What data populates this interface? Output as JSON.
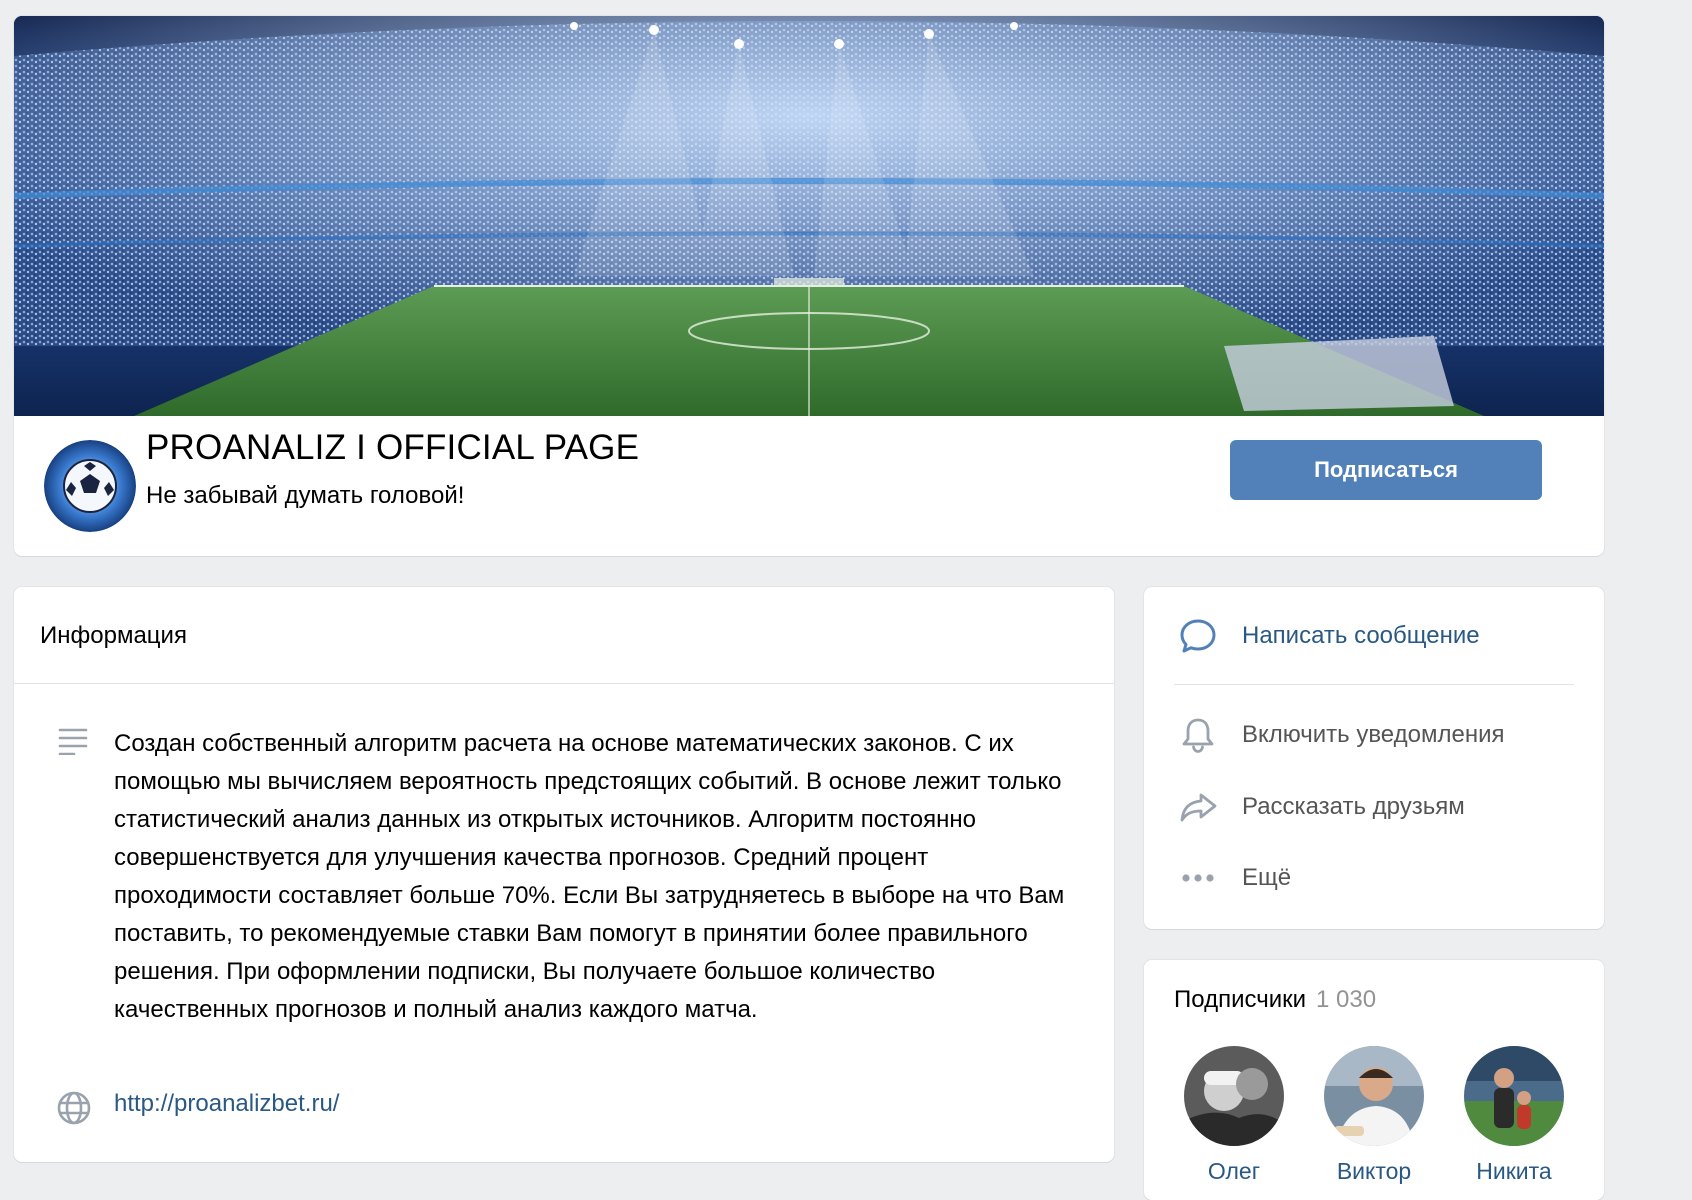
{
  "group": {
    "title": "PROANALIZ I OFFICIAL PAGE",
    "status": "Не забывай думать головой!",
    "subscribe_label": "Подписаться"
  },
  "info": {
    "title": "Информация",
    "description": "Создан собственный алгоритм расчета на основе математических законов. С их помощью мы вычисляем вероятность предстоящих событий. В основе лежит только статистический анализ данных из открытых источников. Алгоритм постоянно совершенствуется для улучшения качества прогнозов. Средний процент проходимости составляет больше 70%. Если Вы затрудняетесь в выборе на что Вам поставить, то рекомендуемые ставки Вам помогут в принятии более правильного решения. При оформлении подписки, Вы получаете большое количество качественных прогнозов и полный анализ каждого матча.",
    "website": "http://proanalizbet.ru/"
  },
  "actions": {
    "message": "Написать сообщение",
    "notifications": "Включить уведомления",
    "share": "Рассказать друзьям",
    "more": "Ещё"
  },
  "followers": {
    "title": "Подписчики",
    "count": "1 030",
    "items": [
      {
        "name": "Олег"
      },
      {
        "name": "Виктор"
      },
      {
        "name": "Никита"
      }
    ]
  },
  "colors": {
    "accent": "#5181b8",
    "link": "#2a5885",
    "background": "#edeef0"
  },
  "icons": {
    "description": "text-lines-icon",
    "website": "globe-icon",
    "message": "speech-bubble-icon",
    "notifications": "bell-icon",
    "share": "share-arrow-icon",
    "more": "more-dots-icon"
  }
}
